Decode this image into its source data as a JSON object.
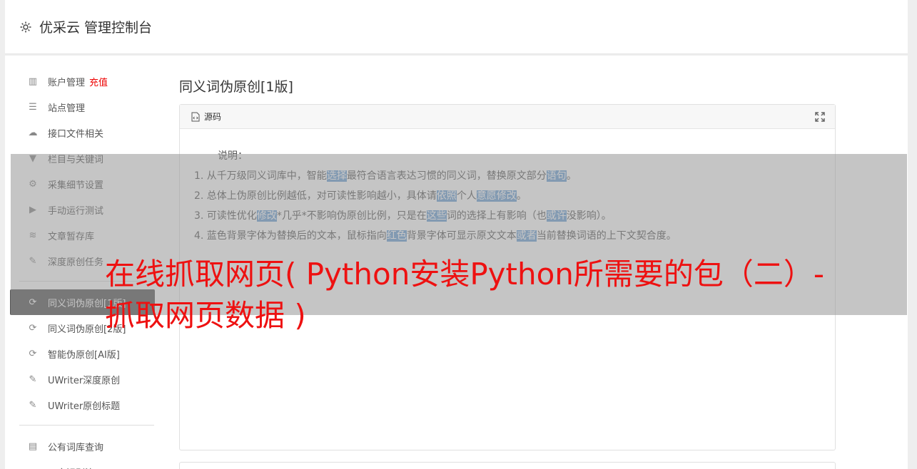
{
  "header": {
    "title": "优采云 管理控制台",
    "icon": "gear-icon"
  },
  "sidebar": {
    "group1": [
      {
        "label": "账户管理",
        "extra": "充值",
        "icon": "bar-chart-icon"
      },
      {
        "label": "站点管理",
        "icon": "server-icon"
      },
      {
        "label": "接口文件相关",
        "icon": "cloud-upload-icon"
      },
      {
        "label": "栏目与关键词",
        "icon": "filter-icon"
      },
      {
        "label": "采集细节设置",
        "icon": "gears-icon"
      },
      {
        "label": "手动运行测试",
        "icon": "play-circle-icon"
      },
      {
        "label": "文章暂存库",
        "icon": "database-icon"
      },
      {
        "label": "深度原创任务",
        "icon": "edit-icon"
      }
    ],
    "group2": [
      {
        "label": "同义词伪原创[1版]",
        "icon": "refresh-icon",
        "active": true
      },
      {
        "label": "同义词伪原创[2版]",
        "icon": "refresh-icon"
      },
      {
        "label": "智能伪原创[AI版]",
        "icon": "refresh-icon"
      },
      {
        "label": "UWriter深度原创",
        "icon": "edit-icon"
      },
      {
        "label": "UWriter原创标题",
        "icon": "edit-icon"
      }
    ],
    "group3": [
      {
        "label": "公有词库查询",
        "icon": "book-icon"
      },
      {
        "label": "正文识别演示",
        "icon": "monitor-icon"
      }
    ]
  },
  "main": {
    "title": "同义词伪原创[1版]",
    "source_label": "源码",
    "intro": "说明：",
    "notes": [
      [
        "1. 从千万级同义词库中，智能",
        {
          "hl": "选择"
        },
        "最符合语言表达习惯的同义词，替换原文部分",
        {
          "hl": "语句"
        },
        "。"
      ],
      [
        "2. 总体上伪原创比例越低，对可读性影响越小，具体请",
        {
          "hl": "依照"
        },
        "个人",
        {
          "hl": "意愿"
        },
        {
          "hl": "修改"
        },
        "。"
      ],
      [
        "3. 可读性优化",
        {
          "hl": "修改"
        },
        "*几乎*不影响伪原创比例，只是在",
        {
          "hl": "这些"
        },
        "词的选择上有影响（也",
        {
          "hl": "或许"
        },
        "没影响）。"
      ],
      [
        "4. 蓝色背景字体为替换后的文本，鼠标指向",
        {
          "hl": "红色"
        },
        "背景字体可显示原文文本",
        {
          "hl": "或者"
        },
        "当前替换词语的上下文契合度。"
      ]
    ]
  },
  "overlay_title": "在线抓取网页( Python安装Python所需要的包（二）-抓取网页数据 )",
  "colors": {
    "highlight": "#6b9fd5",
    "overlay_text": "#ee1111",
    "active_nav": "#555555",
    "recharge": "#ee0000"
  }
}
